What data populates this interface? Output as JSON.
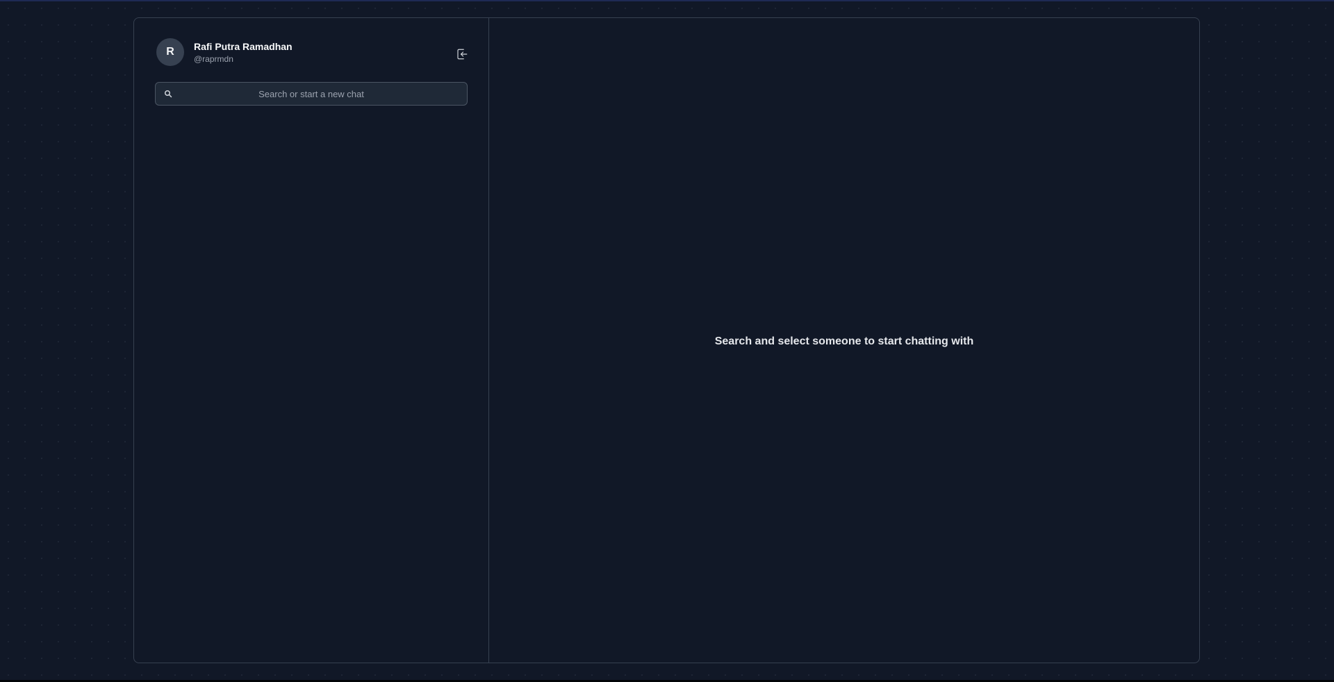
{
  "user": {
    "avatar_initial": "R",
    "name": "Rafi Putra Ramadhan",
    "handle": "@raprmdn"
  },
  "icons": {
    "logout": "logout-icon",
    "search": "search-icon"
  },
  "search": {
    "placeholder": "Search or start a new chat",
    "value": ""
  },
  "main": {
    "empty_message": "Search and select someone to start chatting with"
  },
  "colors": {
    "background": "#111827",
    "border": "#374151",
    "input_background": "#1f2937"
  }
}
